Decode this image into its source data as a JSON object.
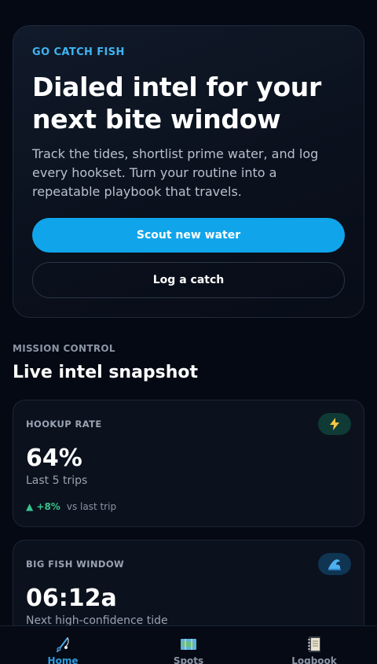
{
  "hero": {
    "eyebrow": "GO CATCH FISH",
    "title": "Dialed intel for your next bite window",
    "body": "Track the tides, shortlist prime water, and log every hookset. Turn your routine into a repeatable playbook that travels.",
    "primary_button": "Scout new water",
    "secondary_button": "Log a catch"
  },
  "section": {
    "eyebrow": "MISSION CONTROL",
    "title": "Live intel snapshot"
  },
  "stats": [
    {
      "label": "HOOKUP RATE",
      "icon": "lightning-icon",
      "value": "64%",
      "sub": "Last 5 trips",
      "delta": "▲ +8%",
      "delta_compare": "vs last trip"
    },
    {
      "label": "BIG FISH WINDOW",
      "icon": "wave-icon",
      "value": "06:12a",
      "sub": "Next high-confidence tide"
    }
  ],
  "tabs": [
    {
      "label": "Home",
      "icon": "fishing-rod-icon",
      "active": true
    },
    {
      "label": "Spots",
      "icon": "map-icon",
      "active": false
    },
    {
      "label": "Logbook",
      "icon": "notebook-icon",
      "active": false
    }
  ],
  "colors": {
    "accent": "#10a5ea",
    "background": "#050913",
    "positive": "#36c48b"
  }
}
